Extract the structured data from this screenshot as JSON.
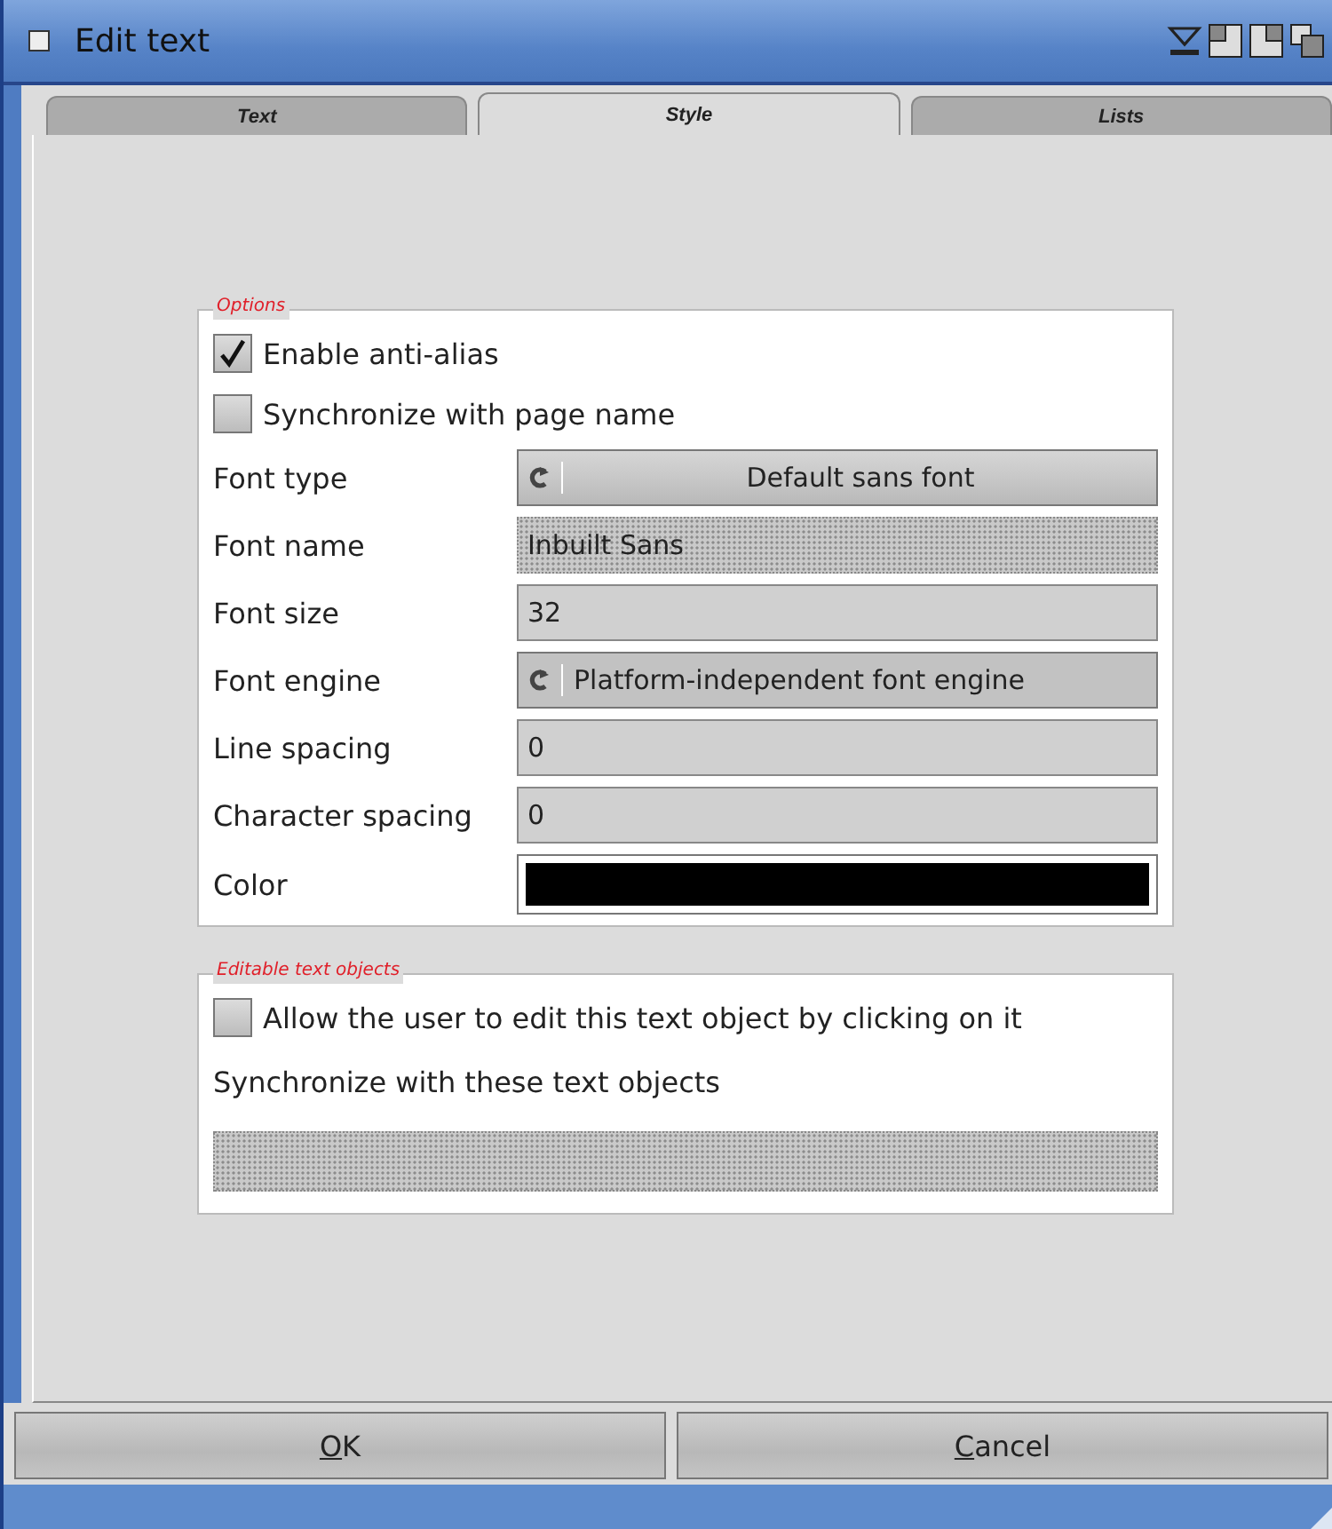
{
  "window": {
    "title": "Edit text"
  },
  "tabs": [
    {
      "label": "Text",
      "selected": false
    },
    {
      "label": "Style",
      "selected": true
    },
    {
      "label": "Lists",
      "selected": false
    }
  ],
  "groups": [
    {
      "title": "Options",
      "rows": [
        {
          "kind": "checkbox",
          "label": "Enable anti-alias",
          "checked": true
        },
        {
          "kind": "checkbox",
          "label": "Synchronize with page name",
          "checked": false
        },
        {
          "kind": "cycle",
          "label": "Font type",
          "value": "Default sans font",
          "disabled": false
        },
        {
          "kind": "text",
          "label": "Font name",
          "value": "Inbuilt Sans",
          "disabled": true
        },
        {
          "kind": "text",
          "label": "Font size",
          "value": "32",
          "disabled": false
        },
        {
          "kind": "cycle",
          "label": "Font engine",
          "value": "Platform-independent font engine",
          "disabled": true
        },
        {
          "kind": "text",
          "label": "Line spacing",
          "value": "0",
          "disabled": false
        },
        {
          "kind": "text",
          "label": "Character spacing",
          "value": "0",
          "disabled": false
        },
        {
          "kind": "color",
          "label": "Color",
          "color": "#000000"
        }
      ]
    },
    {
      "title": "Editable text objects",
      "rows": [
        {
          "kind": "checkbox",
          "label": "Allow the user to edit this text object by clicking on it",
          "checked": false
        },
        {
          "kind": "label",
          "label": "Synchronize with these text objects"
        },
        {
          "kind": "list",
          "disabled": true
        }
      ]
    }
  ],
  "buttons": [
    {
      "key": "O",
      "rest": "K"
    },
    {
      "key": "C",
      "rest": "ancel"
    }
  ]
}
